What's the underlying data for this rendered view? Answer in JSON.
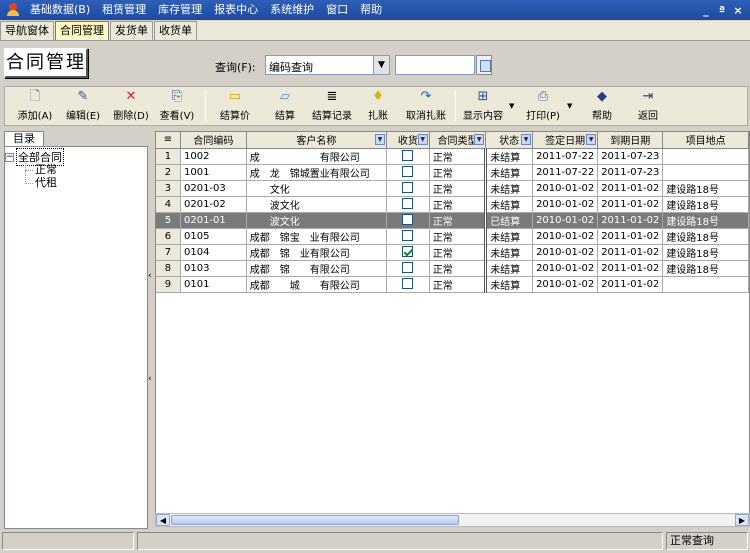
{
  "menu": [
    "基础数据(B)",
    "租赁管理",
    "库存管理",
    "报表中心",
    "系统维护",
    "窗口",
    "帮助"
  ],
  "window_controls": [
    "_",
    "ª",
    "×"
  ],
  "tabs": [
    {
      "label": "导航窗体",
      "active": false
    },
    {
      "label": "合同管理",
      "active": true
    },
    {
      "label": "发货单",
      "active": false
    },
    {
      "label": "收货单",
      "active": false
    }
  ],
  "page_title": "合同管理",
  "query": {
    "label": "查询(F):",
    "selected": "编码查询",
    "value": ""
  },
  "toolbar": {
    "add": "添加(A)",
    "edit": "编辑(E)",
    "delete": "删除(D)",
    "view": "查看(V)",
    "settle_price": "结算价",
    "settle": "结算",
    "settle_record": "结算记录",
    "close_account": "扎账",
    "cancel_close": "取消扎账",
    "show_content": "显示内容",
    "print": "打印(P)",
    "help": "帮助",
    "back": "返回"
  },
  "tree": {
    "tab": "目录",
    "root": "全部合同",
    "children": [
      "正常",
      "代租"
    ]
  },
  "grid": {
    "columns": [
      "合同编码",
      "客户名称",
      "收货",
      "合同类型",
      "状态",
      "签定日期",
      "到期日期",
      "项目地点"
    ],
    "rows": [
      {
        "no": "1",
        "code": "1002",
        "customer": "成　　　　　　有限公司",
        "received": false,
        "type": "正常",
        "status": "未结算",
        "sign": "2011-07-22",
        "due": "2011-07-23",
        "place": ""
      },
      {
        "no": "2",
        "code": "1001",
        "customer": "成　龙　锦城置业有限公司",
        "received": false,
        "type": "正常",
        "status": "未结算",
        "sign": "2011-07-22",
        "due": "2011-07-23",
        "place": ""
      },
      {
        "no": "3",
        "code": "0201-03",
        "customer": "　　文化",
        "received": false,
        "type": "正常",
        "status": "未结算",
        "sign": "2010-01-02",
        "due": "2011-01-02",
        "place": "建设路18号"
      },
      {
        "no": "4",
        "code": "0201-02",
        "customer": "　　波文化",
        "received": false,
        "type": "正常",
        "status": "未结算",
        "sign": "2010-01-02",
        "due": "2011-01-02",
        "place": "建设路18号"
      },
      {
        "no": "5",
        "code": "0201-01",
        "customer": "　　波文化",
        "received": false,
        "type": "正常",
        "status": "已结算",
        "sign": "2010-01-02",
        "due": "2011-01-02",
        "place": "建设路18号"
      },
      {
        "no": "6",
        "code": "0105",
        "customer": "成都　锦宝　业有限公司",
        "received": false,
        "type": "正常",
        "status": "未结算",
        "sign": "2010-01-02",
        "due": "2011-01-02",
        "place": "建设路18号"
      },
      {
        "no": "7",
        "code": "0104",
        "customer": "成都　锦　业有限公司",
        "received": true,
        "type": "正常",
        "status": "未结算",
        "sign": "2010-01-02",
        "due": "2011-01-02",
        "place": "建设路18号"
      },
      {
        "no": "8",
        "code": "0103",
        "customer": "成都　锦　　有限公司",
        "received": false,
        "type": "正常",
        "status": "未结算",
        "sign": "2010-01-02",
        "due": "2011-01-02",
        "place": "建设路18号"
      },
      {
        "no": "9",
        "code": "0101",
        "customer": "成都　　城　　有限公司",
        "received": false,
        "type": "正常",
        "status": "未结算",
        "sign": "2010-01-02",
        "due": "2011-01-02",
        "place": ""
      }
    ],
    "selected_row": 5
  },
  "status": {
    "right": "正常查询"
  }
}
